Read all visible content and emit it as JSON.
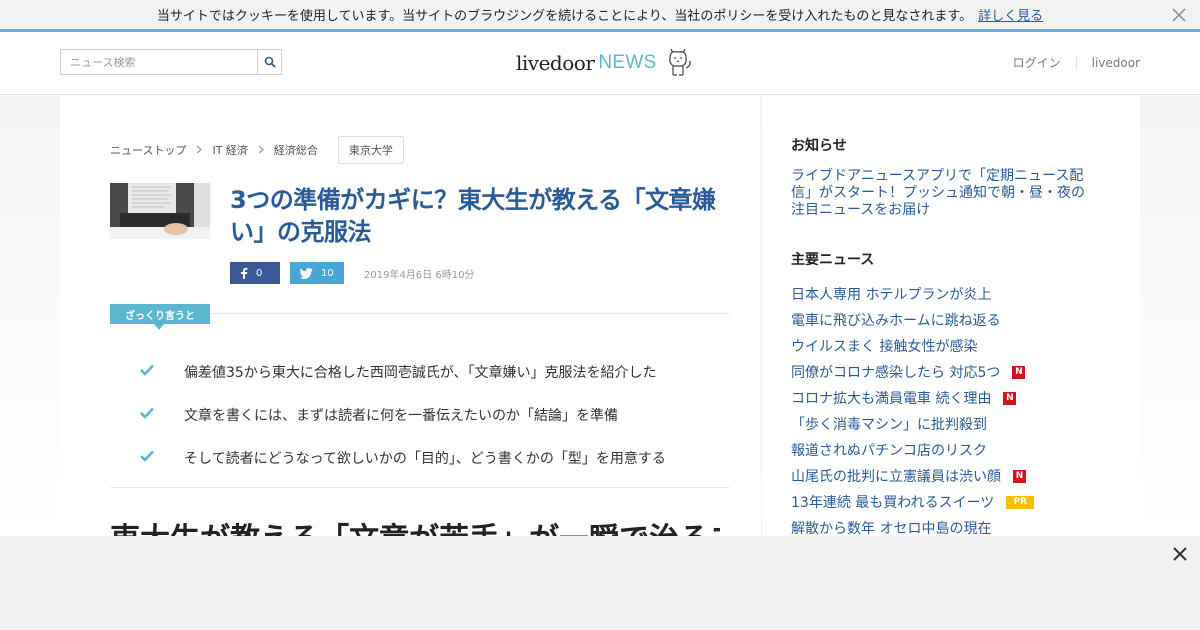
{
  "cookie": {
    "text": "当サイトではクッキーを使用しています。当サイトのブラウジングを続けることにより、当社のポリシーを受け入れたものと見なされます。",
    "link": "詳しく見る"
  },
  "header": {
    "search_placeholder": "ニュース検索",
    "logo_part1": "livedoor",
    "logo_part2": "NEWS",
    "login": "ログイン",
    "livedoor": "livedoor"
  },
  "breadcrumb": {
    "items": [
      "ニューストップ",
      "IT 経済",
      "経済総合"
    ],
    "tag": "東京大学"
  },
  "article": {
    "title": "3つの準備がカギに？東大生が教える「文章嫌い」の克服法",
    "facebook_count": "0",
    "twitter_count": "10",
    "date": "2019年4月6日 6時10分",
    "summary_label": "ざっくり言うと",
    "summary": [
      "偏差値35から東大に合格した西岡壱誠氏が、「文章嫌い」克服法を紹介した",
      "文章を書くには、まずは読者に何を一番伝えたいのか「結論」を準備",
      "そして読者にどうなって欲しいかの「目的」、どう書くかの「型」を用意する"
    ],
    "heading": "東大生が教える「文章が苦手」が一瞬で治るコ"
  },
  "sidebar": {
    "notice_title": "お知らせ",
    "notice_text": "ライブドアニュースアプリで「定期ニュース配信」がスタート！プッシュ通知で朝・昼・夜の注目ニュースをお届け",
    "news_title": "主要ニュース",
    "news": [
      {
        "text": "日本人専用 ホテルプランが炎上",
        "badge": ""
      },
      {
        "text": "電車に飛び込みホームに跳ね返る",
        "badge": ""
      },
      {
        "text": "ウイルスまく 接触女性が感染",
        "badge": ""
      },
      {
        "text": "同僚がコロナ感染したら 対応5つ",
        "badge": "N"
      },
      {
        "text": "コロナ拡大も満員電車 続く理由",
        "badge": "N"
      },
      {
        "text": "「歩く消毒マシン」に批判殺到",
        "badge": ""
      },
      {
        "text": "報道されぬパチンコ店のリスク",
        "badge": ""
      },
      {
        "text": "山尾氏の批判に立憲議員は渋い顔",
        "badge": "N"
      },
      {
        "text": "13年連続 最も買われるスイーツ",
        "badge": "PR"
      },
      {
        "text": "解散から数年 オセロ中島の現在",
        "badge": ""
      }
    ]
  },
  "colors": {
    "accent": "#5bb7cf",
    "link": "#2a5b98",
    "facebook": "#3b5998",
    "twitter": "#4aa6d5",
    "badge_n": "#d5131b",
    "badge_pr": "#f5c000"
  }
}
